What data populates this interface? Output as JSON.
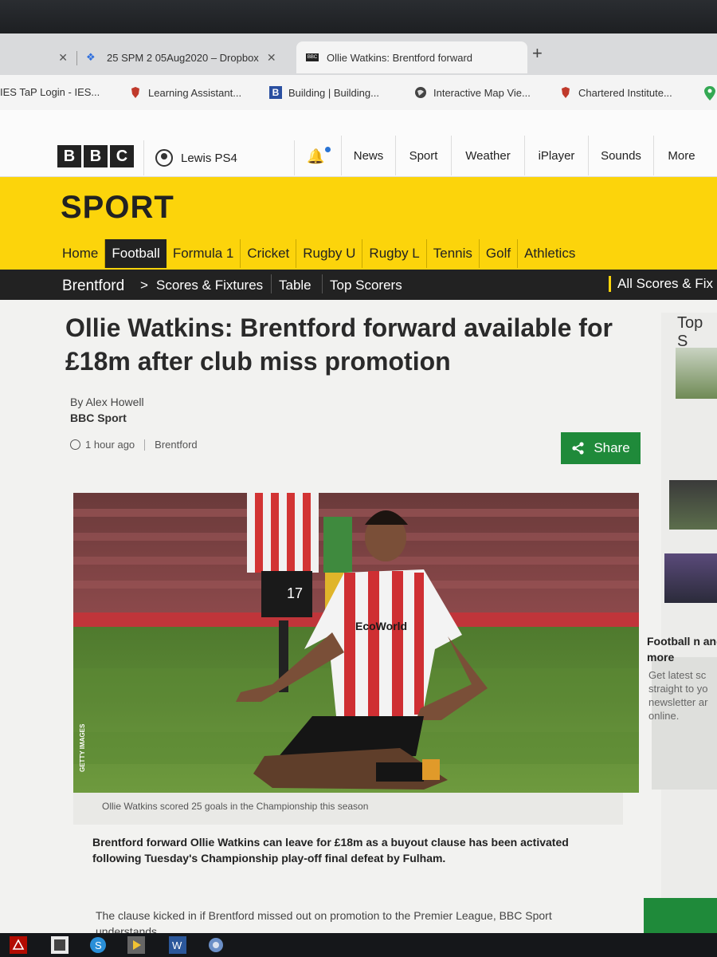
{
  "browser": {
    "tabs": [
      {
        "label": "",
        "active": false
      },
      {
        "label": "25 SPM 2 05Aug2020 – Dropbox",
        "active": false
      },
      {
        "label": "Ollie Watkins: Brentford forward",
        "active": true
      }
    ],
    "new_tab_symbol": "+",
    "bookmarks": [
      {
        "label": "IES TaP Login - IES...",
        "icon": "page-icon"
      },
      {
        "label": "Learning Assistant...",
        "icon": "crest-icon"
      },
      {
        "label": "Building | Building...",
        "icon": "b-icon",
        "icon_text": "B"
      },
      {
        "label": "Interactive Map Vie...",
        "icon": "globe-icon"
      },
      {
        "label": "Chartered Institute...",
        "icon": "crest-icon"
      }
    ]
  },
  "bbc": {
    "logo": [
      "B",
      "B",
      "C"
    ],
    "account": "Lewis PS4",
    "nav": [
      "News",
      "Sport",
      "Weather",
      "iPlayer",
      "Sounds",
      "More"
    ]
  },
  "sport": {
    "title": "SPORT",
    "subnav": [
      "Home",
      "Football",
      "Formula 1",
      "Cricket",
      "Rugby U",
      "Rugby L",
      "Tennis",
      "Golf",
      "Athletics"
    ],
    "active_subnav": "Football",
    "team_bar": {
      "team": "Brentford",
      "chevron": ">",
      "links": [
        "Scores & Fixtures",
        "Table",
        "Top Scorers"
      ],
      "all_scores": "All Scores & Fix"
    }
  },
  "article": {
    "headline": "Ollie Watkins: Brentford forward available for £18m after club miss promotion",
    "author": "By Alex Howell",
    "organisation": "BBC Sport",
    "time": "1 hour ago",
    "section": "Brentford",
    "share_label": "Share",
    "image_credit": "GETTY IMAGES",
    "shirt_number": "17",
    "sponsor": "EcoWorld",
    "caption": "Ollie Watkins scored 25 goals in the Championship this season",
    "lead": "Brentford forward Ollie Watkins can leave for £18m as a buyout clause has been activated following Tuesday's Championship play-off final defeat by Fulham.",
    "paragraph": "The clause kicked in if Brentford missed out on promotion to the Premier League, BBC Sport understands."
  },
  "sidebar": {
    "title": "Top S",
    "promo_title": "Football n and more",
    "promo_body": "Get latest sc straight to yo newsletter ar online."
  },
  "colors": {
    "sport_yellow": "#fcd40b",
    "share_green": "#1f8a3a",
    "dark_bar": "#222222"
  }
}
